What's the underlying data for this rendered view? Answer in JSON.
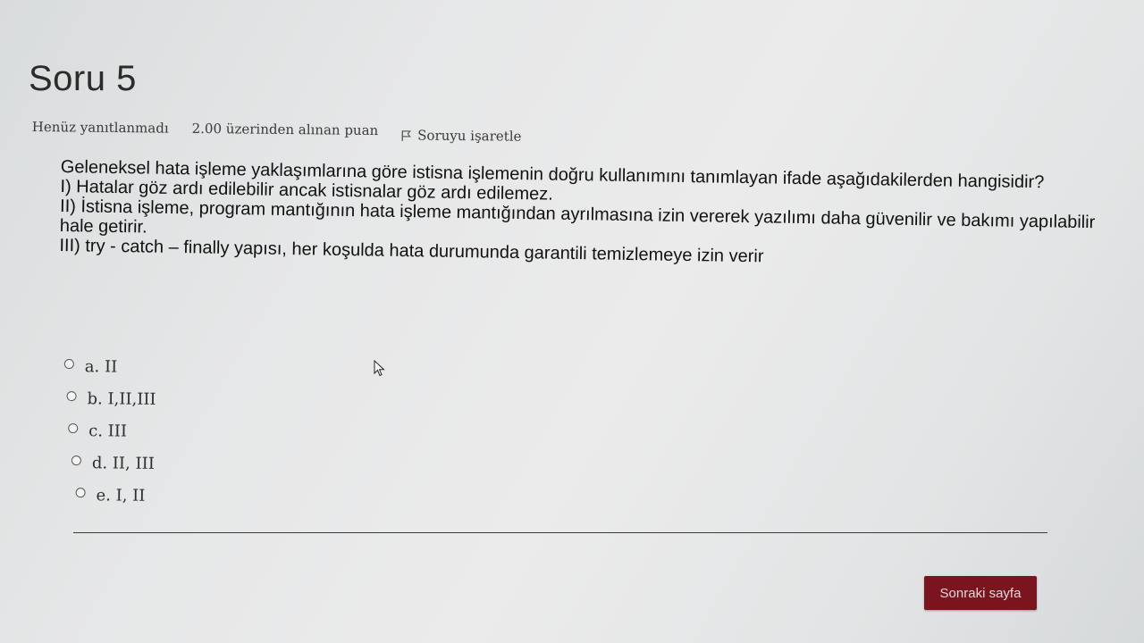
{
  "question": {
    "title": "Soru 5",
    "status": "Henüz yanıtlanmadı",
    "points": "2.00 üzerinden alınan puan",
    "flag_label": "Soruyu işaretle",
    "text_lines": [
      "Geleneksel hata işleme yaklaşımlarına göre istisna işlemenin doğru kullanımını tanımlayan ifade aşağıdakilerden hangisidir?",
      "I) Hatalar göz ardı edilebilir ancak istisnalar göz ardı edilemez.",
      "II) İstisna işleme, program mantığının hata işleme mantığından ayrılmasına izin vererek yazılımı daha güvenilir ve bakımı yapılabilir hale getirir.",
      "III) try - catch – finally yapısı, her koşulda hata durumunda garantili temizlemeye izin verir"
    ]
  },
  "options": [
    {
      "label": "a. II"
    },
    {
      "label": "b. I,II,III"
    },
    {
      "label": "c. III"
    },
    {
      "label": "d. II, III"
    },
    {
      "label": "e. I, II"
    }
  ],
  "navigation": {
    "next_label": "Sonraki sayfa"
  },
  "colors": {
    "next_button": "#7a1520"
  },
  "icons": {
    "flag": "flag-icon",
    "radio": "radio-icon",
    "cursor": "mouse-pointer-icon"
  }
}
